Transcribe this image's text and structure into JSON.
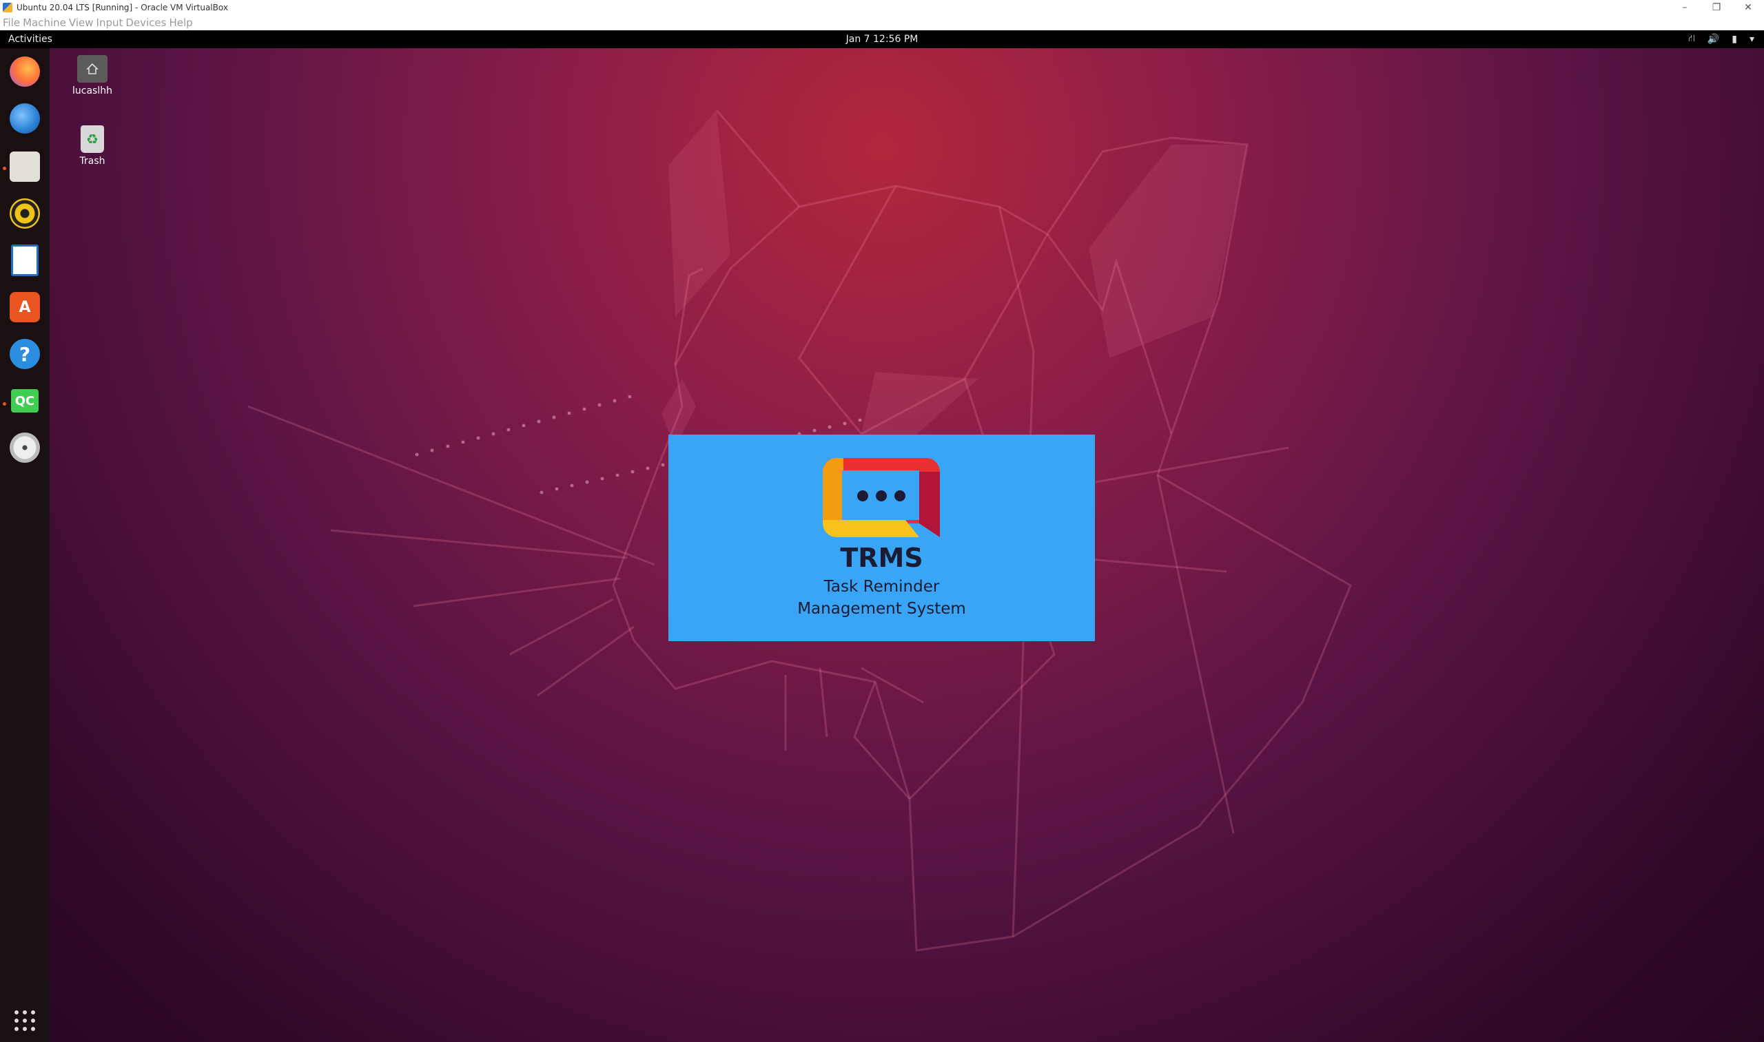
{
  "host_window": {
    "title": "Ubuntu 20.04 LTS [Running] - Oracle VM VirtualBox",
    "menu": [
      "File",
      "Machine",
      "View",
      "Input",
      "Devices",
      "Help"
    ],
    "controls": {
      "minimize": "–",
      "restore": "❐",
      "close": "✕"
    }
  },
  "topbar": {
    "activities": "Activities",
    "clock": "Jan 7  12:56 PM",
    "tray": {
      "network": "⛙",
      "volume": "🔊",
      "battery": "▮",
      "menu": "▾"
    }
  },
  "dock": {
    "items": [
      {
        "name": "firefox-icon",
        "glyph": "",
        "color": "#ff7139",
        "running": false
      },
      {
        "name": "thunderbird-icon",
        "glyph": "",
        "color": "#2a7fd4",
        "running": false
      },
      {
        "name": "files-icon",
        "glyph": "",
        "color": "#d9d6cf",
        "running": true
      },
      {
        "name": "rhythmbox-icon",
        "glyph": "",
        "color": "#f0c419",
        "running": false
      },
      {
        "name": "libreoffice-writer-icon",
        "glyph": "",
        "color": "#1e6ec8",
        "running": false
      },
      {
        "name": "ubuntu-software-icon",
        "glyph": "A",
        "color": "#e95420",
        "running": false
      },
      {
        "name": "help-icon",
        "glyph": "?",
        "color": "#2a8de0",
        "running": false
      },
      {
        "name": "qt-creator-icon",
        "glyph": "QC",
        "color": "#41cd52",
        "running": true
      },
      {
        "name": "dvd-icon",
        "glyph": "",
        "color": "#d8d8d8",
        "running": false
      }
    ],
    "show_apps": "⋮⋮⋮"
  },
  "desktop_icons": [
    {
      "label": "lucaslhh"
    },
    {
      "label": "Trash"
    }
  ],
  "splash": {
    "title": "TRMS",
    "subtitle_line1": "Task Reminder",
    "subtitle_line2": "Management System",
    "background": "#3aa5f5"
  }
}
